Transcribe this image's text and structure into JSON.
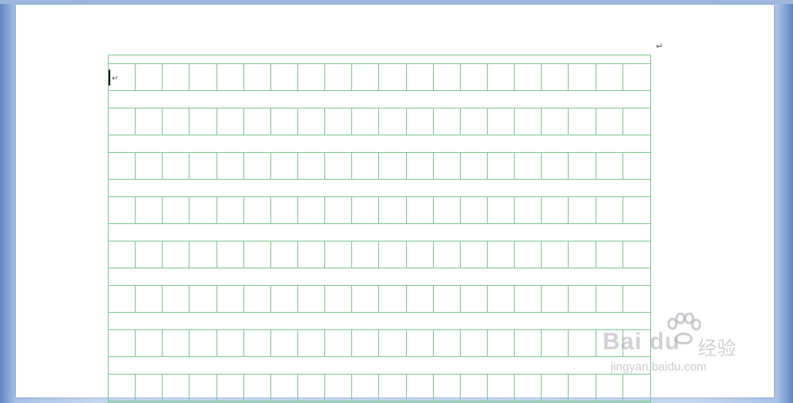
{
  "document": {
    "paragraph_mark": "↵",
    "cell_paragraph_mark": "↵",
    "grid": {
      "columns": 20,
      "visible_rows": 8,
      "line_color": "#7fc48f"
    }
  },
  "watermark": {
    "brand": "Bai du",
    "brand_cn": "经验",
    "url": "jingyan.baidu.com",
    "icon": "paw-icon"
  },
  "colors": {
    "page": "#ffffff",
    "workspace": "#c6d8f0",
    "grid": "#7fc48f"
  }
}
